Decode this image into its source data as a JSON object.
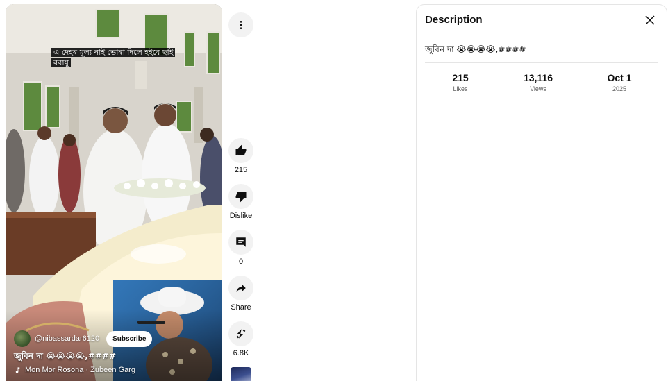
{
  "video": {
    "overlay_caption": "এ দেহৰ মূল্য নাই ভোৰা দিলে হইবে ছাই ৰবায়ু",
    "channel_handle": "@nibassardar6120",
    "subscribe_label": "Subscribe",
    "title": "জুবিন দা 😭😭😭😭,####",
    "music": "Mon Mor Rosona · Zubeen Garg"
  },
  "actions": {
    "more_icon": "more-vert-icon",
    "like": {
      "icon": "thumb-up-icon",
      "label": "215"
    },
    "dislike": {
      "icon": "thumb-down-icon",
      "label": "Dislike"
    },
    "comments": {
      "icon": "comment-icon",
      "label": "0"
    },
    "share": {
      "icon": "share-icon",
      "label": "Share"
    },
    "remix": {
      "icon": "remix-icon",
      "label": "6.8K"
    }
  },
  "description_panel": {
    "title": "Description",
    "close_icon": "close-icon",
    "text": "জুবিন দা 😭😭😭😭,####",
    "stats": [
      {
        "value": "215",
        "label": "Likes"
      },
      {
        "value": "13,116",
        "label": "Views"
      },
      {
        "value": "Oct 1",
        "label": "2025"
      }
    ]
  },
  "colors": {
    "button_bg": "#f2f2f2",
    "text_primary": "#0f0f0f",
    "text_secondary": "#606060",
    "border": "#e5e5e5"
  }
}
